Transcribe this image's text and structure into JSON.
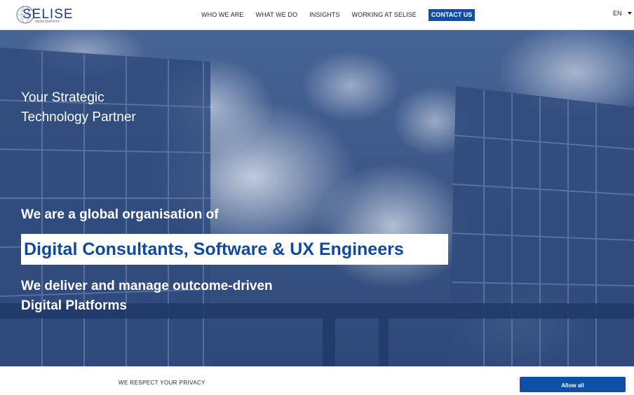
{
  "brand": {
    "name": "SELISE",
    "tagline_small": "digital platforms"
  },
  "nav": {
    "items": [
      {
        "label": "WHO WE ARE"
      },
      {
        "label": "WHAT WE DO"
      },
      {
        "label": "INSIGHTS"
      },
      {
        "label": "WORKING AT SELISE"
      }
    ],
    "cta_label": "CONTACT US",
    "language": "EN"
  },
  "hero": {
    "tagline_line1": "Your Strategic",
    "tagline_line2": "Technology Partner",
    "intro": "We are a global organisation of",
    "highlight": "Digital Consultants, Software & UX Engineers",
    "deliver_line1": "We deliver and manage outcome-driven",
    "deliver_line2": "Digital Platforms"
  },
  "cookie": {
    "title": "WE RESPECT YOUR PRIVACY",
    "allow_label": "Allow all"
  },
  "colors": {
    "brand_blue": "#0e4fa8",
    "highlight_text": "#1249a0",
    "hero_overlay": "#3b5687"
  }
}
